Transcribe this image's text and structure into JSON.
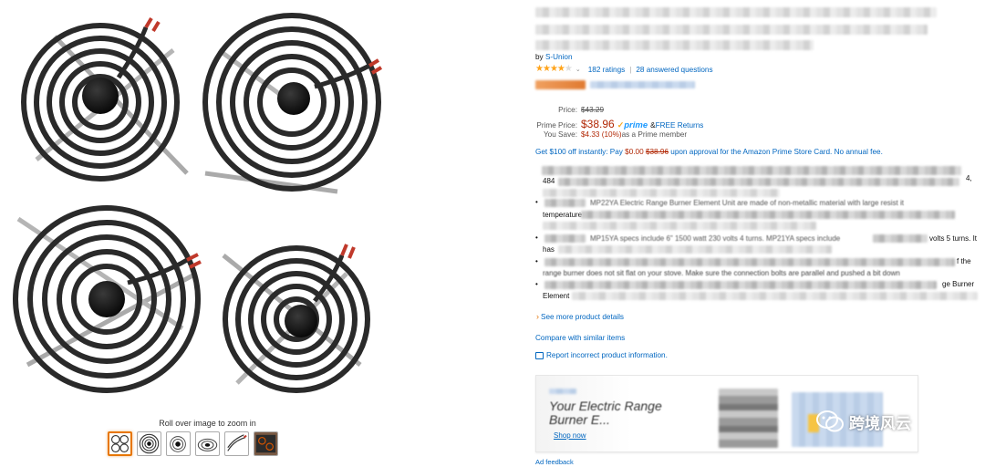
{
  "gallery": {
    "zoom_hint": "Roll over image to zoom in",
    "thumbnails": [
      {
        "name": "four-burner-set",
        "selected": true
      },
      {
        "name": "single-coil-top"
      },
      {
        "name": "coil-side-view"
      },
      {
        "name": "coil-angle-view"
      },
      {
        "name": "coil-terminals"
      },
      {
        "name": "installed-on-stove"
      }
    ]
  },
  "product": {
    "by_prefix": "by ",
    "brand": "S-Union",
    "rating": 4,
    "ratings_count": "182 ratings",
    "answered_questions": "28 answered questions"
  },
  "pricing": {
    "price_label": "Price:",
    "list_price": "$43.29",
    "prime_label": "Prime Price:",
    "prime_price": "$38.96",
    "prime_badge": "prime",
    "free_returns_prefix": "& ",
    "free_returns": "FREE Returns",
    "save_label": "You Save:",
    "save_amount": "$4.33 (10%)",
    "save_suffix": " as a Prime member"
  },
  "promo": {
    "text_a": "Get $100 off instantly: Pay ",
    "pay_amount": "$0.00",
    "orig_amount": "$38.96",
    "text_b": " upon approval for the Amazon Prime Store Card. No annual fee."
  },
  "bullets": {
    "line1_tail": "4,",
    "line1b_head": "484",
    "line2": "MP22YA Electric Range Burner Element Unit are made of non-metallic material with large resist it",
    "line2b": "temperature",
    "line3": "MP15YA specs include 6\" 1500 watt 230 volts 4 turns. MP21YA specs include",
    "line3_tail": "volts 5 turns. It",
    "line3b": "has",
    "line4_tail": "f the",
    "line4b": "range burner does not sit flat on your stove. Make sure the connection bolts are parallel and pushed a bit down",
    "line5_tail": "ge Burner",
    "line5b": "Element"
  },
  "links": {
    "see_more": "See more product details",
    "compare": "Compare with similar items",
    "report": "Report incorrect product information."
  },
  "ad": {
    "headline": "Your Electric Range Burner E...",
    "shop_now": "Shop now",
    "feedback": "Ad feedback"
  },
  "watermark": {
    "text": "跨境风云"
  }
}
